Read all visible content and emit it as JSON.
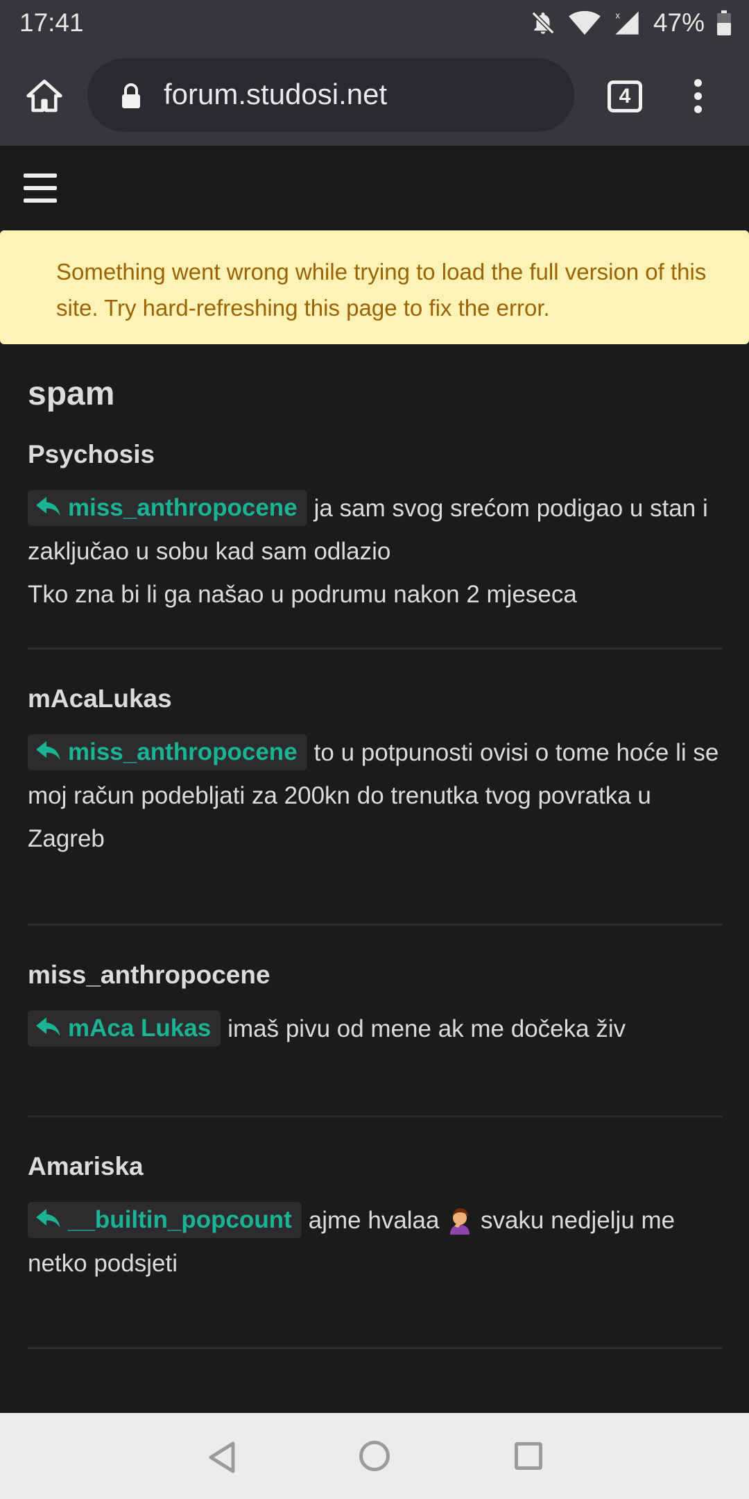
{
  "status_bar": {
    "time": "17:41",
    "battery_percent": "47%",
    "icons": [
      "mute-icon",
      "wifi-icon",
      "signal-icon",
      "battery-icon"
    ]
  },
  "browser": {
    "url": "forum.studosi.net",
    "tab_count": "4"
  },
  "alert": {
    "text": "Something went wrong while trying to load the full version of this site. Try hard-refreshing this page to fix the error."
  },
  "page": {
    "title": "spam"
  },
  "posts": [
    {
      "author": "Psychosis",
      "reply_to": "miss_anthropocene",
      "text_1": "ja sam svog srećom podigao u stan i zaključao u sobu kad sam odlazio",
      "text_2": "Tko zna bi li ga našao u podrumu nakon 2 mjeseca"
    },
    {
      "author": "mAcaLukas",
      "reply_to": "miss_anthropocene",
      "text_1": "to u potpunosti ovisi o tome hoće li se moj račun podebljati za 200kn do trenutka tvog povratka u Zagreb"
    },
    {
      "author": "miss_anthropocene",
      "reply_to": "mAca Lukas",
      "text_1": "imaš pivu od mene ak me dočeka živ"
    },
    {
      "author": "Amariska",
      "reply_to": "__builtin_popcount",
      "text_1a": "ajme hvalaa",
      "text_1b": "svaku nedjelju me netko podsjeti",
      "emoji": "facepalm-emoji"
    }
  ],
  "colors": {
    "accent": "#1ab394",
    "alert_bg": "#fef3b5",
    "alert_text": "#9a6305",
    "background": "#1b1b1c"
  }
}
